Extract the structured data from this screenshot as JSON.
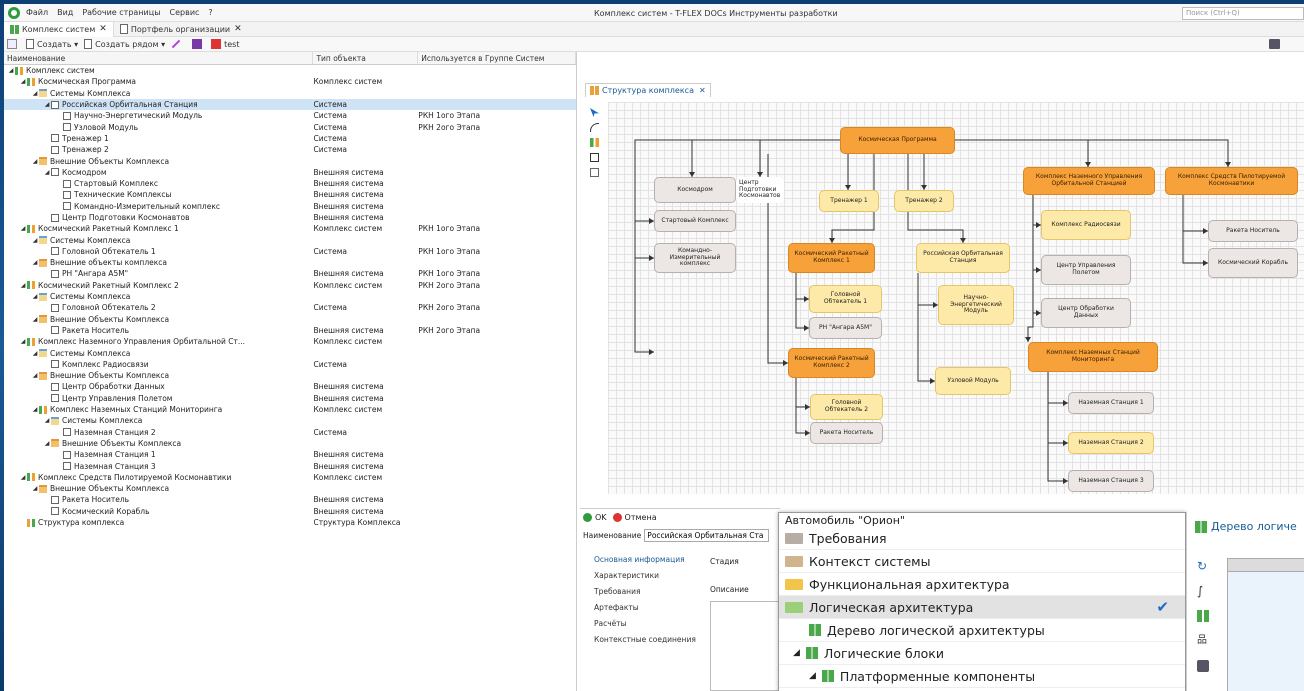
{
  "menu": {
    "items": [
      "Файл",
      "Вид",
      "Рабочие страницы",
      "Сервис",
      "?"
    ],
    "title": "Комплекс систем - T-FLEX DOCs Инструменты разработки",
    "search_placeholder": "Поиск (Ctrl+Q)"
  },
  "doc_tabs": [
    {
      "label": "Комплекс систем"
    },
    {
      "label": "Портфель организации"
    }
  ],
  "toolbar": {
    "create": "Создать",
    "create_near": "Создать рядом",
    "test": "test"
  },
  "tree": {
    "headers": [
      "Наименование",
      "Тип объекта",
      "Используется в Группе Систем"
    ],
    "rows": [
      {
        "name": "Комплекс систем",
        "type": "",
        "group": ""
      },
      {
        "name": "Космическая Программа",
        "type": "Комплекс систем",
        "group": ""
      },
      {
        "name": "Системы Комплекса",
        "type": "",
        "group": ""
      },
      {
        "name": "Российская Орбитальная Станция",
        "type": "Система",
        "group": ""
      },
      {
        "name": "Научно-Энергетический Модуль",
        "type": "Система",
        "group": "РКН 1ого Этапа"
      },
      {
        "name": "Узловой Модуль",
        "type": "Система",
        "group": "РКН 2ого Этапа"
      },
      {
        "name": "Тренажер 1",
        "type": "Система",
        "group": ""
      },
      {
        "name": "Тренажер 2",
        "type": "Система",
        "group": ""
      },
      {
        "name": "Внешние Объекты Комплекса",
        "type": "",
        "group": ""
      },
      {
        "name": "Космодром",
        "type": "Внешняя система",
        "group": ""
      },
      {
        "name": "Стартовый Комплекс",
        "type": "Внешняя система",
        "group": ""
      },
      {
        "name": "Технические Комплексы",
        "type": "Внешняя система",
        "group": ""
      },
      {
        "name": "Командно-Измерительный комплекс",
        "type": "Внешняя система",
        "group": ""
      },
      {
        "name": "Центр Подготовки Космонавтов",
        "type": "Внешняя система",
        "group": ""
      },
      {
        "name": "Космический Ракетный Комплекс 1",
        "type": "Комплекс систем",
        "group": "РКН 1ого Этапа"
      },
      {
        "name": "Системы Комплекса",
        "type": "",
        "group": ""
      },
      {
        "name": "Головной Обтекатель 1",
        "type": "Система",
        "group": "РКН 1ого Этапа"
      },
      {
        "name": "Внешние объекты комплекса",
        "type": "",
        "group": ""
      },
      {
        "name": "РН \"Ангара А5М\"",
        "type": "Внешняя система",
        "group": "РКН 1ого Этапа"
      },
      {
        "name": "Космический Ракетный Комплекс 2",
        "type": "Комплекс систем",
        "group": "РКН 2ого Этапа"
      },
      {
        "name": "Системы Комплекса",
        "type": "",
        "group": ""
      },
      {
        "name": "Головной Обтекатель 2",
        "type": "Система",
        "group": "РКН 2ого Этапа"
      },
      {
        "name": "Внешние Объекты Комплекса",
        "type": "",
        "group": ""
      },
      {
        "name": "Ракета Носитель",
        "type": "Внешняя система",
        "group": "РКН 2ого Этапа"
      },
      {
        "name": "Комплекс Наземного Управления Орбитальной Ст...",
        "type": "Комплекс систем",
        "group": ""
      },
      {
        "name": "Системы Комплекса",
        "type": "",
        "group": ""
      },
      {
        "name": "Комплекс Радиосвязи",
        "type": "Система",
        "group": ""
      },
      {
        "name": "Внешние Объекты Комплекса",
        "type": "",
        "group": ""
      },
      {
        "name": "Центр Обработки Данных",
        "type": "Внешняя система",
        "group": ""
      },
      {
        "name": "Центр Управления Полетом",
        "type": "Внешняя система",
        "group": ""
      },
      {
        "name": "Комплекс Наземных Станций Мониторинга",
        "type": "Комплекс систем",
        "group": ""
      },
      {
        "name": "Системы Комплекса",
        "type": "",
        "group": ""
      },
      {
        "name": "Наземная Станция 2",
        "type": "Система",
        "group": ""
      },
      {
        "name": "Внешние Объекты Комплекса",
        "type": "",
        "group": ""
      },
      {
        "name": "Наземная Станция 1",
        "type": "Внешняя система",
        "group": ""
      },
      {
        "name": "Наземная Станция 3",
        "type": "Внешняя система",
        "group": ""
      },
      {
        "name": "Комплекс Средств Пилотируемой Космонавтики",
        "type": "Комплекс систем",
        "group": ""
      },
      {
        "name": "Внешние Объекты Комплекса",
        "type": "",
        "group": ""
      },
      {
        "name": "Ракета Носитель",
        "type": "Внешняя система",
        "group": ""
      },
      {
        "name": "Космический Корабль",
        "type": "Внешняя система",
        "group": ""
      },
      {
        "name": "Структура комплекса",
        "type": "Структура Комплекса",
        "group": ""
      }
    ]
  },
  "diagram": {
    "tab_label": "Структура комплекса",
    "nodes": {
      "prog": "Космическая Программа",
      "kosmodrom": "Космодром",
      "cpk": "Центр Подготовки Космонавтов",
      "tr1": "Тренажер 1",
      "tr2": "Тренажер 2",
      "knu": "Комплекс Наземного Управления Орбитальной Станцией",
      "kspk": "Комплекс Средств Пилотируемой Космонавтики",
      "start": "Стартовый Комплекс",
      "kik": "Командно-Измерительный комплекс",
      "krk1": "Космический Ракетный Комплекс 1",
      "ros": "Российская Орбитальная Станция",
      "radio": "Комплекс Радиосвязи",
      "raketa1": "Ракета Носитель",
      "cup": "Центр Управления Полетом",
      "korabl": "Космический Корабль",
      "go1": "Головной Обтекатель 1",
      "nem": "Научно-Энергетический Модуль",
      "angara": "РН \"Ангара А5М\"",
      "cod": "Центр Обработки Данных",
      "knsm": "Комплекс Наземных Станций Мониторинга",
      "krk2": "Космический Ракетный Комплекс 2",
      "uzel": "Узловой Модуль",
      "ns1": "Наземная Станция 1",
      "go2": "Головной Обтекатель 2",
      "ns2": "Наземная Станция 2",
      "raketa2": "Ракета Носитель",
      "ns3": "Наземная Станция 3"
    }
  },
  "props": {
    "ok": "OK",
    "cancel": "Отмена",
    "name_label": "Наименование",
    "name_value": "Российская Орбитальная Ста",
    "tabs": [
      "Основная информация",
      "Характеристики",
      "Требования",
      "Артефакты",
      "Расчёты",
      "Контекстные соединения"
    ],
    "stage": "Стадия",
    "desc": "Описание"
  },
  "popup": {
    "items": [
      "Автомобиль \"Орион\"",
      "Требования",
      "Контекст системы",
      "Функциональная архитектура",
      "Логическая архитектура",
      "Дерево логической архитектуры",
      "Логические блоки",
      "Платформенные компоненты"
    ]
  },
  "right_panel": {
    "title": "Дерево логиче"
  }
}
